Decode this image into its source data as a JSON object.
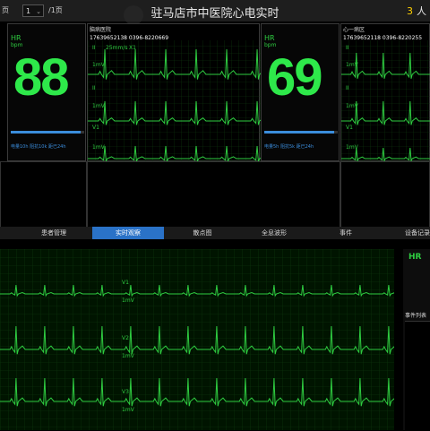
{
  "topbar": {
    "left_label": "页",
    "page_value": "1",
    "page_total": "/1页",
    "title": "驻马店市中医院心电实时",
    "count_num": "3",
    "count_unit": "人"
  },
  "panels": [
    {
      "hr_label": "HR",
      "hr_unit": "bpm",
      "hr_value": "88",
      "meta": "电量10h 阻抗10k 距已24h",
      "progress": 0.95
    },
    {
      "hr_label": "HR",
      "hr_unit": "bpm",
      "hr_value": "69",
      "meta": "电量5h 阻抗5k 距已24h",
      "progress": 0.95
    }
  ],
  "ecg_panels": [
    {
      "header": "脑病医院",
      "phone": "17639652138  0396-8220669",
      "lead_top": "II",
      "lead_mid": "II",
      "lead_bot": "V1",
      "scale_top": "1mV",
      "scale_mid": "1mV",
      "scale_bot": "1mV",
      "speed": "25mm/s",
      "mode": "X1"
    },
    {
      "header": "心一病区",
      "phone": "17639652118  0396-8220255",
      "lead_top": "II",
      "lead_mid": "II",
      "lead_bot": "V1",
      "scale_top": "1mV",
      "scale_mid": "1mV",
      "scale_bot": "1mV"
    }
  ],
  "tabs": [
    "患者管理",
    "实时观察",
    "散点图",
    "全息波形",
    "事件",
    "设备记录"
  ],
  "main_ecg": {
    "lead1": "V1",
    "lead2": "V2",
    "lead3": "V3",
    "scale1": "1mV",
    "scale2": "1mV",
    "scale3": "1mV"
  },
  "side": {
    "hr_label": "HR",
    "event_list": "事件列表"
  },
  "colors": {
    "accent": "#2a72c7",
    "ecg": "#2ecc40",
    "hr": "#2ee84a",
    "grid": "#0f3a0f",
    "count": "#ffd000"
  }
}
